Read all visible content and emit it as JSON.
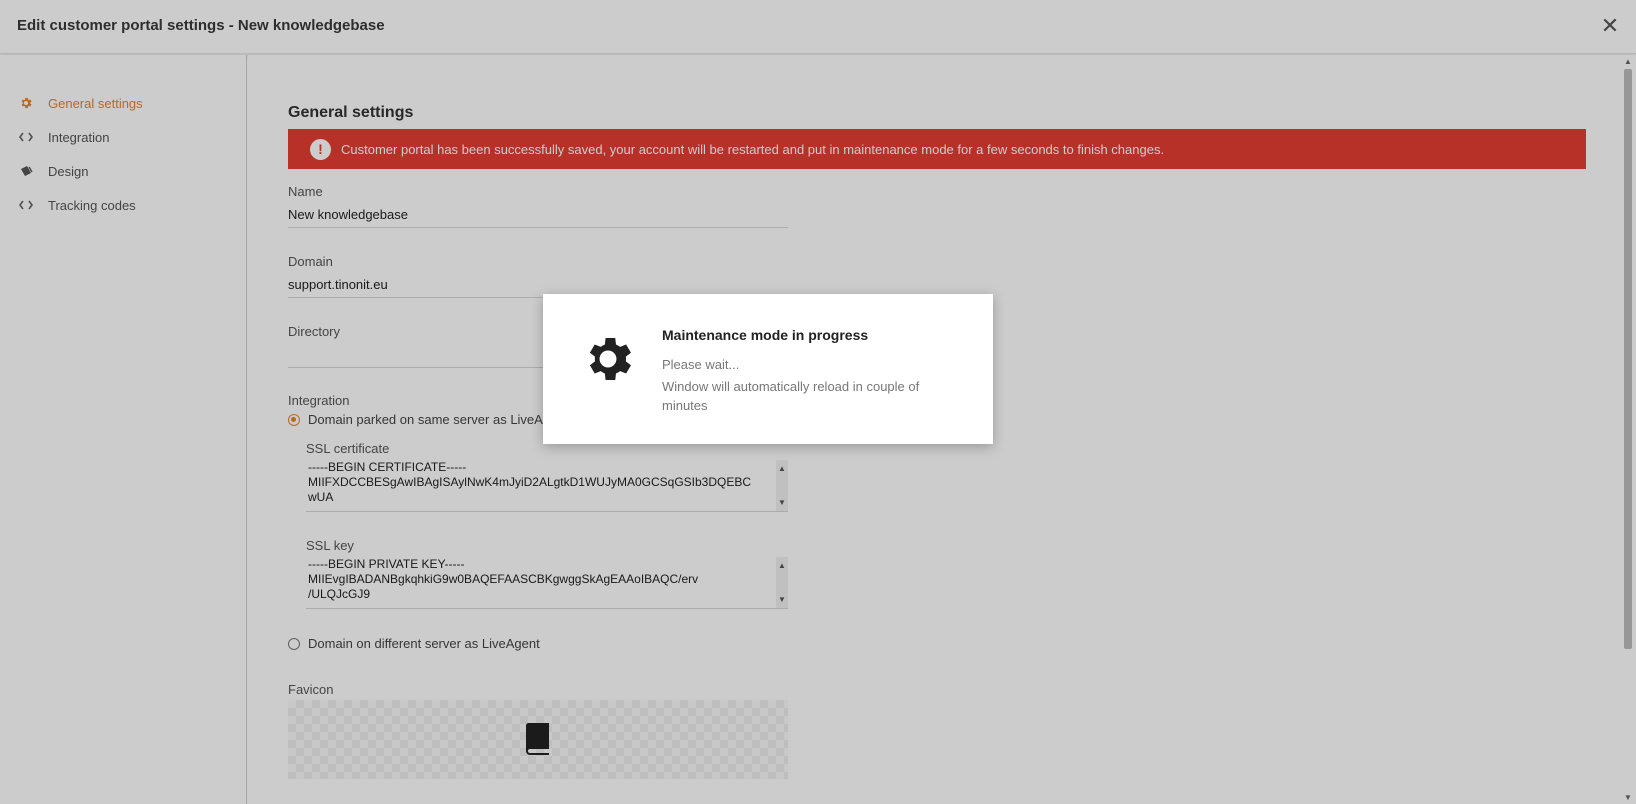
{
  "window": {
    "title": "Edit customer portal settings - New knowledgebase",
    "close_label": "✕"
  },
  "sidebar": {
    "items": [
      {
        "label": "General settings",
        "icon": "gear-icon",
        "active": true
      },
      {
        "label": "Integration",
        "icon": "code-icon",
        "active": false
      },
      {
        "label": "Design",
        "icon": "paint-bucket-icon",
        "active": false
      },
      {
        "label": "Tracking codes",
        "icon": "code-icon",
        "active": false
      }
    ]
  },
  "main": {
    "heading": "General settings",
    "alert": {
      "icon": "!",
      "text": "Customer portal has been successfully saved, your account will be restarted and put in maintenance mode for a few seconds to finish changes.",
      "color": "#e53e32"
    },
    "name": {
      "label": "Name",
      "value": "New knowledgebase"
    },
    "domain": {
      "label": "Domain",
      "value": "support.tinonit.eu"
    },
    "directory": {
      "label": "Directory",
      "value": ""
    },
    "integration": {
      "label": "Integration",
      "option_same": "Domain parked on same server as LiveAgent",
      "option_different": "Domain on different server as LiveAgent",
      "selected": "same"
    },
    "ssl_certificate": {
      "label": "SSL certificate",
      "lines": [
        "-----BEGIN CERTIFICATE-----",
        "MIIFXDCCBESgAwIBAgISAylNwK4mJyiD2ALgtkD1WUJyMA0GCSqGSIb3DQEBC",
        "wUA"
      ]
    },
    "ssl_key": {
      "label": "SSL key",
      "lines": [
        "-----BEGIN PRIVATE KEY-----",
        "MIIEvgIBADANBgkqhkiG9w0BAQEFAASCBKgwggSkAgEAAoIBAQC/erv",
        "/ULQJcGJ9"
      ]
    },
    "favicon": {
      "label": "Favicon",
      "icon": "book-icon"
    }
  },
  "modal": {
    "icon": "gear-icon",
    "title": "Maintenance mode in progress",
    "subtitle": "Please wait...",
    "text": "Window will automatically reload in couple of minutes"
  },
  "colors": {
    "accent": "#e5842f",
    "alert": "#e53e32"
  }
}
